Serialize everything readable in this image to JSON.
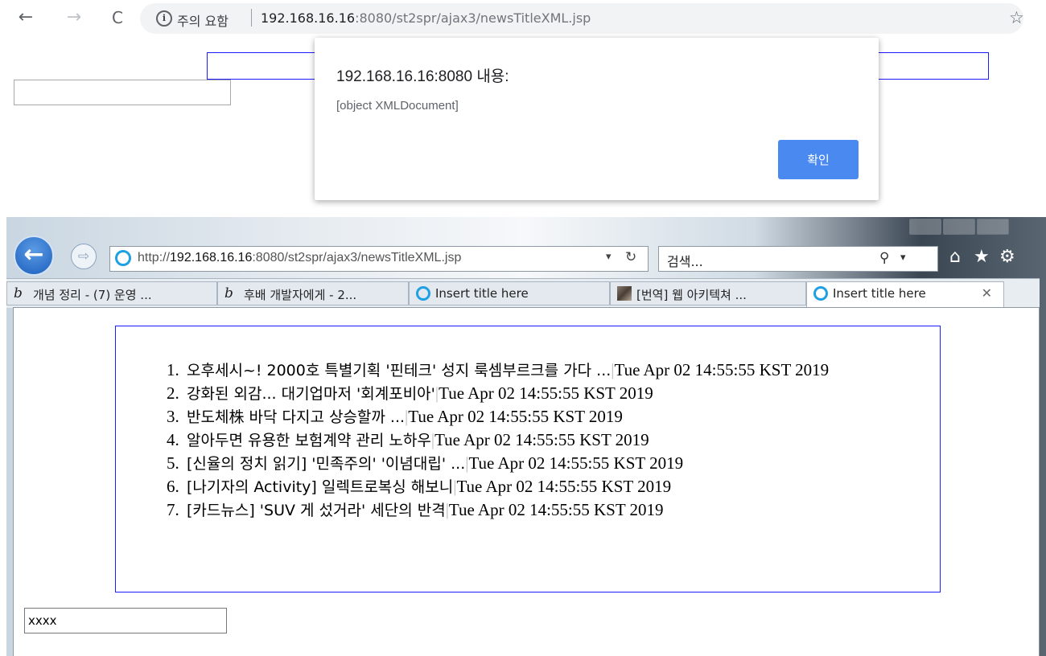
{
  "chrome": {
    "security_warning": "주의 요함",
    "url_host": "192.168.16.16",
    "url_rest": ":8080/st2spr/ajax3/newsTitleXML.jsp"
  },
  "alert": {
    "title": "192.168.16.16:8080 내용:",
    "message": "[object XMLDocument]",
    "ok_label": "확인"
  },
  "ie": {
    "url_scheme": "http://",
    "url_host": "192.168.16.16",
    "url_rest": ":8080/st2spr/ajax3/newsTitleXML.jsp",
    "search_placeholder": "검색...",
    "tabs": [
      {
        "label": "개념 정리 - (7) 운영 ...",
        "icon": "pen-icon"
      },
      {
        "label": "후배 개발자에게 - 2...",
        "icon": "pen-icon"
      },
      {
        "label": "Insert title here",
        "icon": "ie-icon"
      },
      {
        "label": "[번역] 웹 아키텍쳐 ...",
        "icon": "thumbnail-icon"
      },
      {
        "label": "Insert title here",
        "icon": "ie-icon",
        "active": true
      }
    ],
    "news": [
      {
        "title": "오후세시~! 2000호 특별기획 '핀테크' 성지 룩셈부르크를 가다 ...",
        "date": "Tue Apr 02 14:55:55 KST 2019"
      },
      {
        "title": "강화된 외감... 대기업마저 '회계포비아'",
        "date": "Tue Apr 02 14:55:55 KST 2019"
      },
      {
        "title": "반도체株 바닥 다지고 상승할까 ...",
        "date": "Tue Apr 02 14:55:55 KST 2019"
      },
      {
        "title": "알아두면 유용한 보험계약 관리 노하우",
        "date": "Tue Apr 02 14:55:55 KST 2019"
      },
      {
        "title": "[신율의 정치 읽기] '민족주의' '이념대립' ...",
        "date": "Tue Apr 02 14:55:55 KST 2019"
      },
      {
        "title": "[나기자의 Activity] 일렉트로복싱 해보니",
        "date": "Tue Apr 02 14:55:55 KST 2019"
      },
      {
        "title": "[카드뉴스] 'SUV 게 섰거라' 세단의 반격",
        "date": "Tue Apr 02 14:55:55 KST 2019"
      }
    ],
    "input_value": "xxxx"
  }
}
